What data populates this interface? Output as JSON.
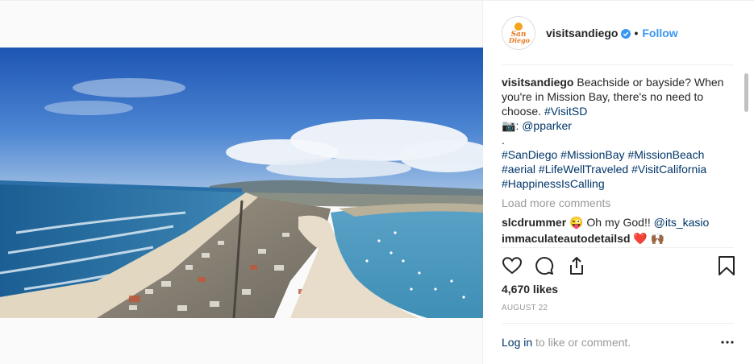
{
  "header": {
    "username": "visitsandiego",
    "separator": "•",
    "follow_label": "Follow",
    "avatar_text": "San Diego"
  },
  "caption": {
    "username": "visitsandiego",
    "text_line1": "Beachside or bayside? When you're in Mission Bay, there's no need to choose.",
    "tag_line1": "#VisitSD",
    "camera_emoji": "📷",
    "credit": ": @pparker",
    "dot": ".",
    "hashtags": [
      "#SanDiego",
      "#MissionBay",
      "#MissionBeach",
      "#aerial",
      "#LifeWellTraveled",
      "#VisitCalifornia",
      "#HappinessIsCalling"
    ]
  },
  "load_more_label": "Load more comments",
  "comments": [
    {
      "username": "slcdrummer",
      "emoji": "😜",
      "text": "Oh my God!!",
      "mention": "@its_kasio"
    },
    {
      "username": "immaculateautodetailsd",
      "emoji": "❤️ 🙌🏾",
      "text": "",
      "mention": ""
    }
  ],
  "likes_label": "4,670 likes",
  "date_label": "August 22",
  "footer": {
    "login_link": "Log in",
    "login_rest": "to like or comment."
  },
  "icons": [
    "verified-badge-icon",
    "heart-icon",
    "comment-icon",
    "share-icon",
    "bookmark-icon",
    "more-options-icon"
  ],
  "colors": {
    "link": "#003569",
    "follow": "#3897f0",
    "muted": "#999999",
    "verified": "#3897f0"
  }
}
